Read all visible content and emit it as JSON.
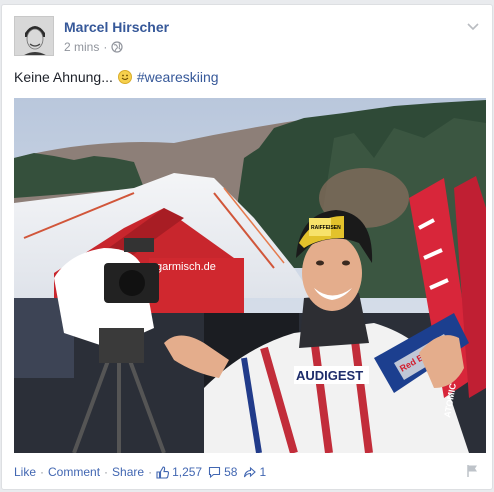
{
  "post": {
    "author": "Marcel Hirscher",
    "timestamp": "2 mins",
    "privacy_icon": "globe-icon",
    "text": "Keine Ahnung...",
    "emoji": "smile-emoji-icon",
    "hashtag": "#weareskiing"
  },
  "photo": {
    "banner_text": "garmisch.de",
    "helmet_brand": "RAIFFEISEN",
    "jersey_text": "AUDIGEST",
    "can_brand": "Red Bull",
    "ski_brand": "ATOMIC"
  },
  "actions": {
    "like_label": "Like",
    "comment_label": "Comment",
    "share_label": "Share",
    "likes_count": "1,257",
    "comments_count": "58",
    "shares_count": "1"
  },
  "colors": {
    "link_blue": "#365899",
    "action_blue": "#4267b2",
    "meta_grey": "#90949c",
    "text_dark": "#1d2129"
  }
}
